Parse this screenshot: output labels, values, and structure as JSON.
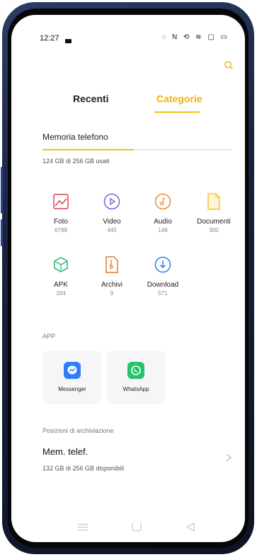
{
  "status_bar": {
    "time": "12:27",
    "icons": "◌ N ⟲ ≋ ▢ ▭"
  },
  "tabs": [
    {
      "label": "Recenti",
      "active": false
    },
    {
      "label": "Categorie",
      "active": true
    }
  ],
  "storage_summary": {
    "label": "Memoria telefono",
    "used": "124 GB di 256 GB usati",
    "used_fraction": 0.48
  },
  "categories": [
    {
      "name": "Foto",
      "count": "6788",
      "icon": "image-icon",
      "color": "#e0414f"
    },
    {
      "name": "Video",
      "count": "445",
      "icon": "play-icon",
      "color": "#7b63d6"
    },
    {
      "name": "Audio",
      "count": "148",
      "icon": "music-icon",
      "color": "#ef8a2b"
    },
    {
      "name": "Documenti",
      "count": "300",
      "icon": "document-icon",
      "color": "#f5c43a"
    },
    {
      "name": "APK",
      "count": "334",
      "icon": "package-icon",
      "color": "#2bb673"
    },
    {
      "name": "Archivi",
      "count": "9",
      "icon": "archive-icon",
      "color": "#e07b2f"
    },
    {
      "name": "Download",
      "count": "571",
      "icon": "download-icon",
      "color": "#2b7de9"
    }
  ],
  "apps_section": {
    "label": "APP",
    "apps": [
      {
        "name": "Messenger",
        "icon": "messenger-icon",
        "color": "#2d7ff9"
      },
      {
        "name": "WhatsApp",
        "icon": "whatsapp-icon",
        "color": "#25c46b"
      }
    ]
  },
  "storage_locations": {
    "label": "Posizioni di archiviazione",
    "title": "Mem. telef.",
    "subtitle": "132 GB di 256 GB disponibili"
  },
  "colors": {
    "accent": "#f3c21a",
    "accent_text": "#f0b400"
  },
  "nav_bar": {
    "icons": [
      "menu-icon",
      "home-icon",
      "back-icon"
    ]
  }
}
